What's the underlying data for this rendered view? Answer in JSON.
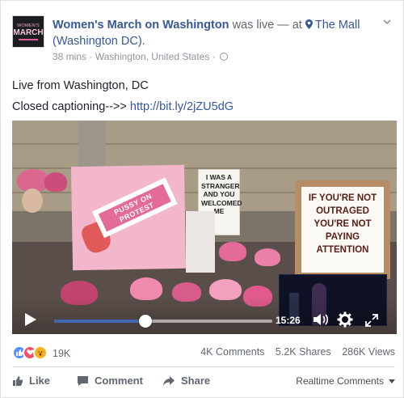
{
  "post": {
    "page_name": "Women's March on Washington",
    "status_text": "was live — at",
    "location": "The Mall (Washington DC).",
    "time_ago": "38 mins",
    "separator": "·",
    "place": "Washington, United States",
    "avatar_text_top": "WOMEN'S",
    "avatar_text_main": "MARCH"
  },
  "caption": {
    "line1": "Live from Washington, DC",
    "line2_prefix": "Closed captioning-->>",
    "line2_link": "http://bit.ly/2jZU5dG"
  },
  "video": {
    "signs": {
      "pink_band": "PUSSY ON PROTEST",
      "white_sign": "I WAS A STRANGER AND YOU WELCOMED ME",
      "card_sign": "IF YOU'RE NOT OUTRAGED YOU'RE NOT PAYING ATTENTION"
    },
    "time_remaining": "15:26",
    "progress_fraction": 0.42
  },
  "stats": {
    "reaction_count": "19K",
    "comments": "4K Comments",
    "shares": "5.2K Shares",
    "views": "286K Views"
  },
  "actions": {
    "like": "Like",
    "comment": "Comment",
    "share": "Share",
    "realtime": "Realtime Comments"
  },
  "colors": {
    "link": "#365899",
    "progress": "#4267b2",
    "sign_pink": "#f3b7cc"
  },
  "icons": [
    "location-pin-icon",
    "globe-icon",
    "chevron-down-icon",
    "play-icon",
    "volume-icon",
    "gear-icon",
    "fullscreen-icon",
    "like-icon",
    "comment-icon",
    "share-icon"
  ]
}
